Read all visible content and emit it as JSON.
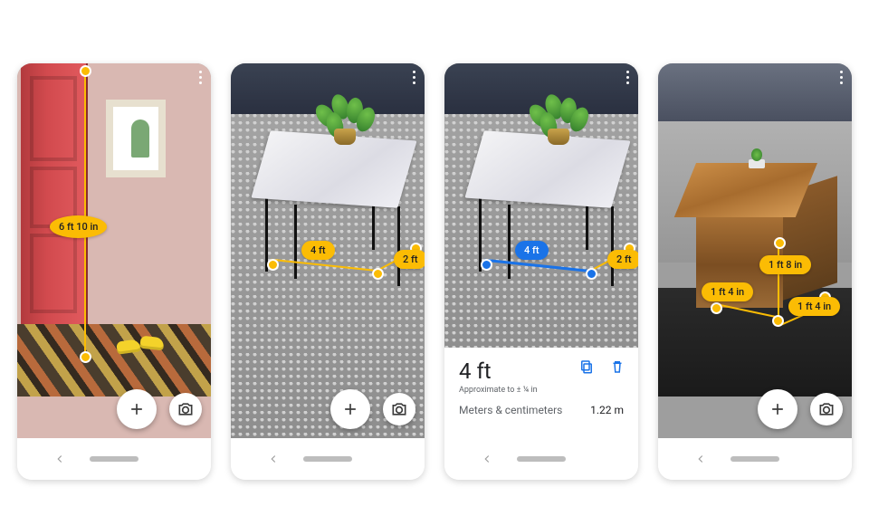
{
  "phones": [
    {
      "id": "door",
      "measurements": [
        {
          "text": "6 ft 10 in",
          "style": "yellow"
        }
      ]
    },
    {
      "id": "table-yellow",
      "measurements": [
        {
          "text": "4 ft",
          "style": "yellow"
        },
        {
          "text": "2 ft",
          "style": "yellow"
        }
      ]
    },
    {
      "id": "table-blue",
      "measurements": [
        {
          "text": "4 ft",
          "style": "blue"
        },
        {
          "text": "2 ft",
          "style": "yellow"
        }
      ],
      "sheet": {
        "title": "4 ft",
        "subtitle": "Approximate to ± ¼ in",
        "unit_label": "Meters & centimeters",
        "unit_value": "1.22 m"
      }
    },
    {
      "id": "wood-cube",
      "measurements": [
        {
          "text": "1 ft 8 in",
          "style": "yellow"
        },
        {
          "text": "1 ft 4 in",
          "style": "yellow"
        },
        {
          "text": "1 ft 4 in",
          "style": "yellow"
        }
      ]
    }
  ],
  "icons": {
    "overflow": "more-vert-icon",
    "add": "plus-icon",
    "camera": "camera-icon",
    "copy": "copy-icon",
    "delete": "trash-icon",
    "back": "back-icon",
    "home_pill": "home-pill"
  },
  "colors": {
    "accent_yellow": "#fbbc04",
    "accent_blue": "#1a73e8"
  }
}
